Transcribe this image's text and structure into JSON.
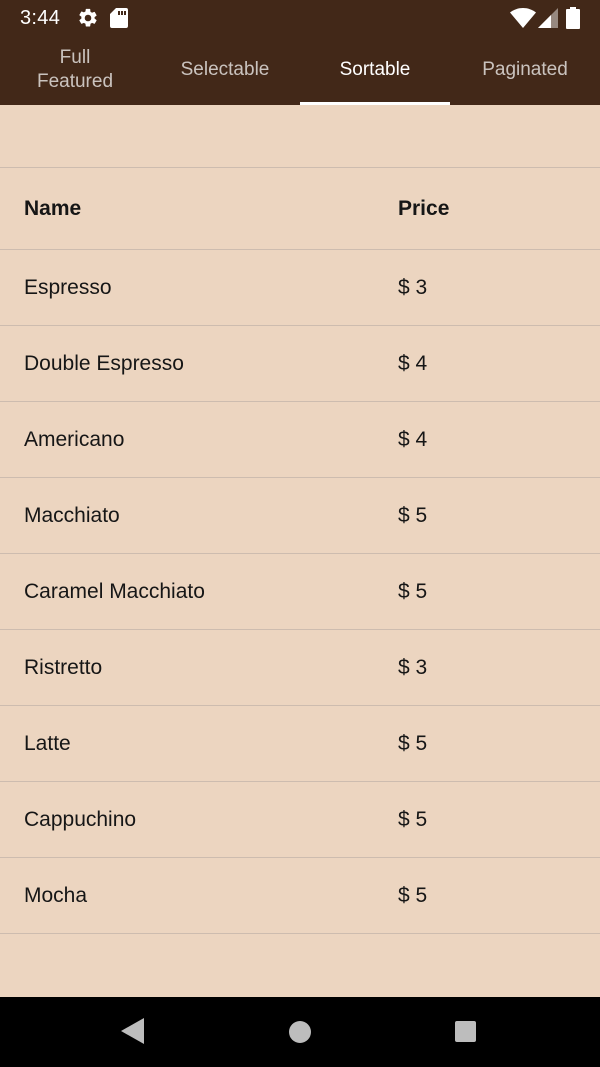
{
  "status_bar": {
    "time": "3:44",
    "icons": [
      "gear-icon",
      "sd-card-icon",
      "wifi-icon",
      "cell-signal-icon",
      "battery-icon"
    ]
  },
  "tabs": [
    {
      "label": "Full\nFeatured",
      "active": false
    },
    {
      "label": "Selectable",
      "active": false
    },
    {
      "label": "Sortable",
      "active": true
    },
    {
      "label": "Paginated",
      "active": false
    }
  ],
  "table": {
    "headers": {
      "name": "Name",
      "price": "Price"
    },
    "rows": [
      {
        "name": "Espresso",
        "price": "$ 3"
      },
      {
        "name": "Double Espresso",
        "price": "$ 4"
      },
      {
        "name": "Americano",
        "price": "$ 4"
      },
      {
        "name": "Macchiato",
        "price": "$ 5"
      },
      {
        "name": "Caramel Macchiato",
        "price": "$ 5"
      },
      {
        "name": "Ristretto",
        "price": "$ 3"
      },
      {
        "name": "Latte",
        "price": "$ 5"
      },
      {
        "name": "Cappuchino",
        "price": "$ 5"
      },
      {
        "name": "Mocha",
        "price": "$ 5"
      }
    ]
  },
  "nav_bar": {
    "icons": [
      "back-icon",
      "home-icon",
      "recents-icon"
    ]
  },
  "colors": {
    "app_bar": "#422818",
    "background": "#ecd5c0",
    "divider": "#cdbcaf",
    "text": "#161616"
  }
}
